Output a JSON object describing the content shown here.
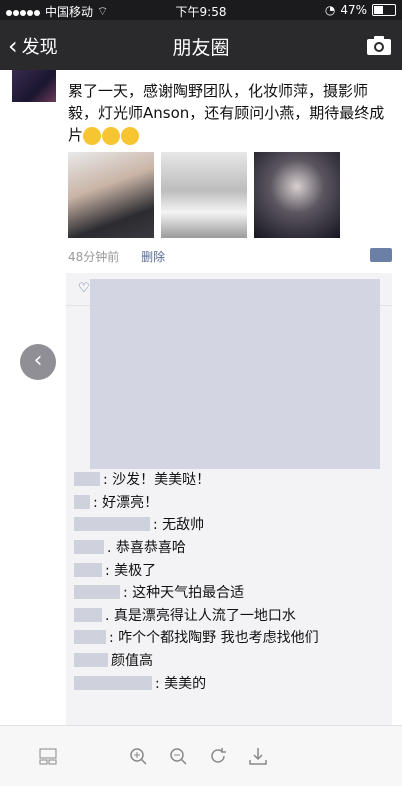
{
  "status_bar": {
    "carrier": "中国移动",
    "time": "下午9:58",
    "battery": "47%",
    "battery_level": 0.47
  },
  "nav": {
    "back_label": "发现",
    "title": "朋友圈"
  },
  "post": {
    "text": "累了一天，感谢陶野团队，化妆师萍，摄影师毅，灯光师Anson，还有顾问小燕，期待最终成片",
    "emoji_count": 3,
    "time_ago": "48分钟前",
    "delete_label": "删除"
  },
  "comments": [
    {
      "name_width": 26,
      "text": ": 沙发！美美哒！"
    },
    {
      "name_width": 16,
      "text": ": 好漂亮！"
    },
    {
      "name_width": 76,
      "text": ": 无敌帅"
    },
    {
      "name_width": 30,
      "text": ". 恭喜恭喜哈"
    },
    {
      "name_width": 28,
      "text": ": 美极了"
    },
    {
      "name_width": 46,
      "text": ": 这种天气拍最合适"
    },
    {
      "name_width": 28,
      "text": ". 真是漂亮得让人流了一地口水"
    },
    {
      "name_width": 32,
      "text": ": 咋个个都找陶野 我也考虑找他们"
    },
    {
      "name_width": 34,
      "text": "颜值高"
    },
    {
      "name_width": 78,
      "text": ": 美美的"
    }
  ],
  "toolbar": {
    "items": [
      "grid-icon",
      "zoom-in-icon",
      "zoom-out-icon",
      "rotate-icon",
      "download-icon"
    ]
  },
  "colors": {
    "link": "#576b95",
    "nav_bg": "#2a2a2d"
  }
}
